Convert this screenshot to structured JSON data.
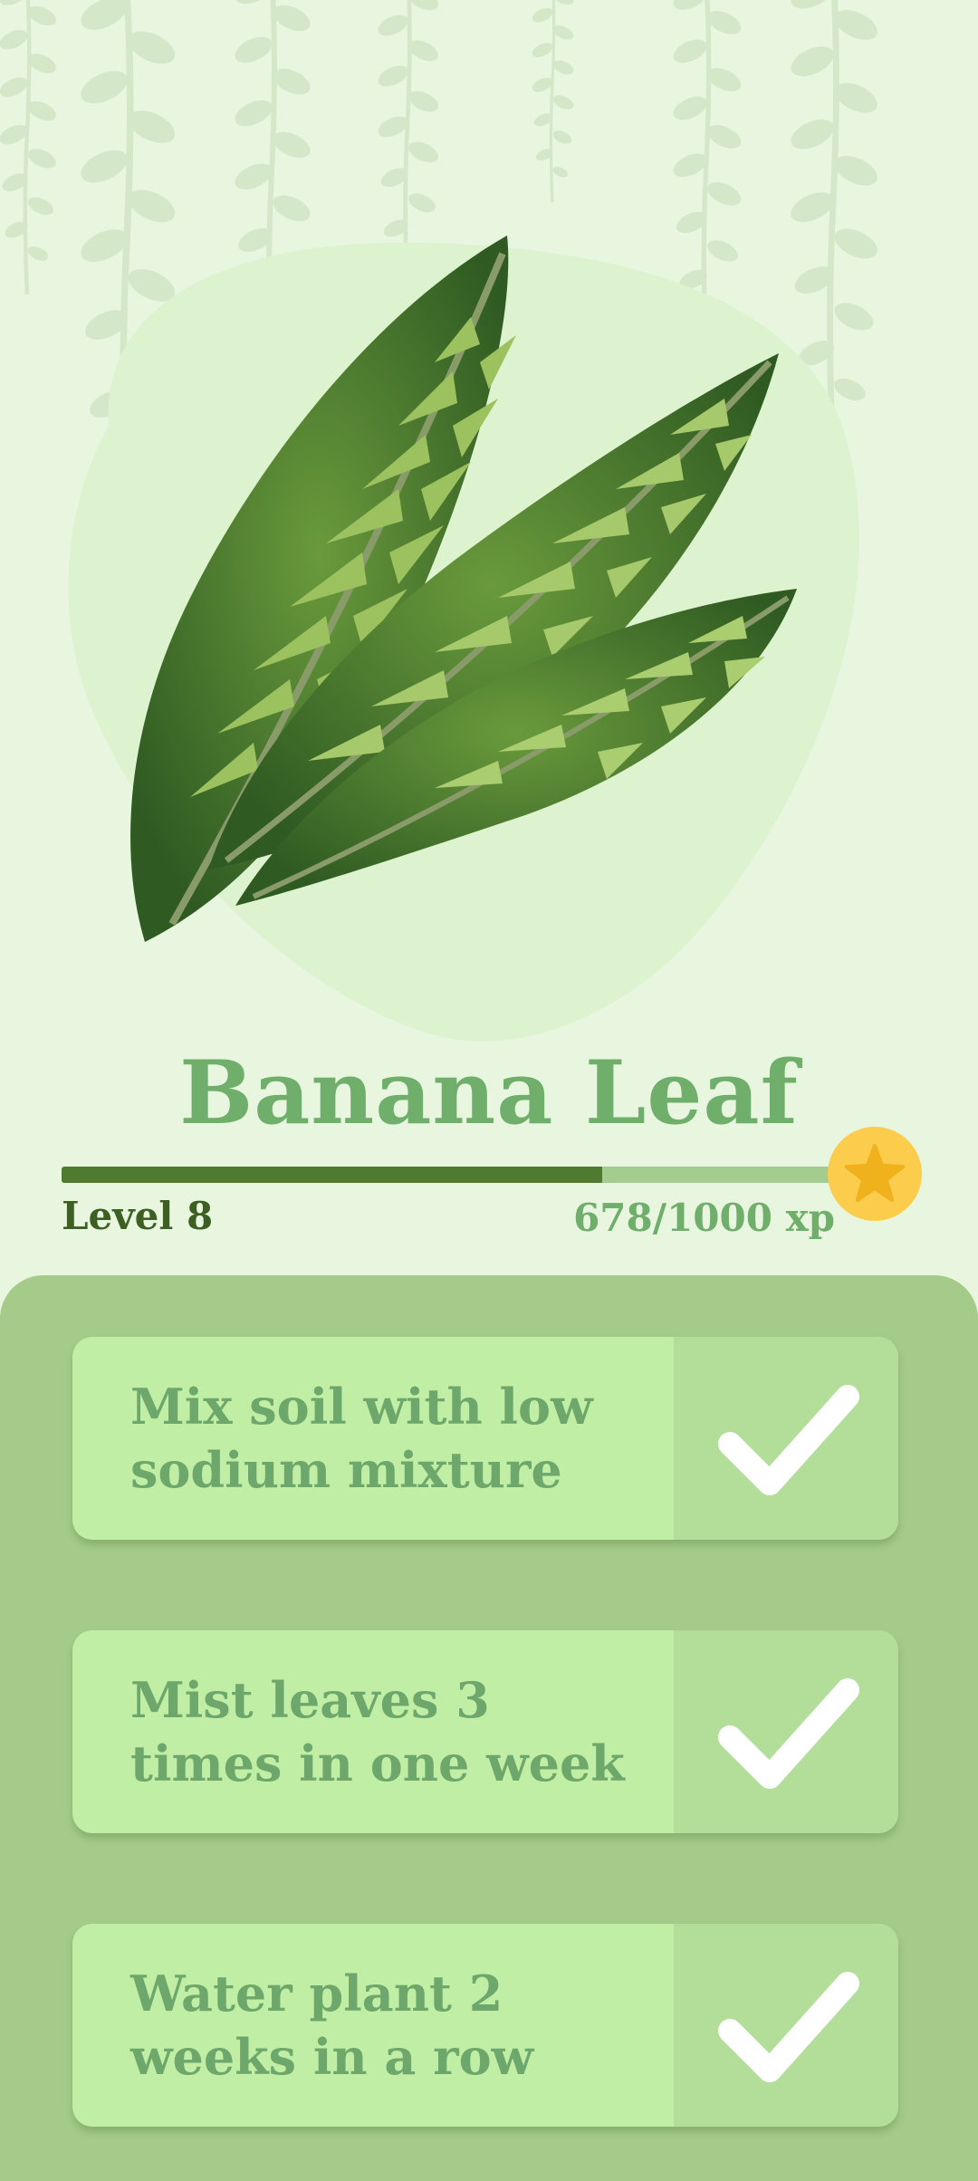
{
  "plant": {
    "name": "Banana Leaf",
    "level_label": "Level 8",
    "xp_label": "678/1000 xp",
    "xp_progress": 0.678
  },
  "tasks": [
    {
      "label": "Mix soil with low sodium mixture",
      "completed": true
    },
    {
      "label": "Mist leaves 3 times in one week",
      "completed": true
    },
    {
      "label": "Water plant 2 weeks in a row",
      "completed": true
    }
  ],
  "icons": {
    "badge": "star-icon",
    "task_complete": "checkmark-icon",
    "illustration": "banana-leaf-illustration",
    "background": "hanging-vine-decoration"
  },
  "colors": {
    "background": "#e8f6df",
    "title": "#6fae6b",
    "progress_fill": "#4f7a30",
    "progress_track": "#a3cc8e",
    "badge": "#fccc4d",
    "panel": "#a4cb89",
    "task_card": "#c1eea5",
    "task_check_bg": "#b3de99"
  }
}
